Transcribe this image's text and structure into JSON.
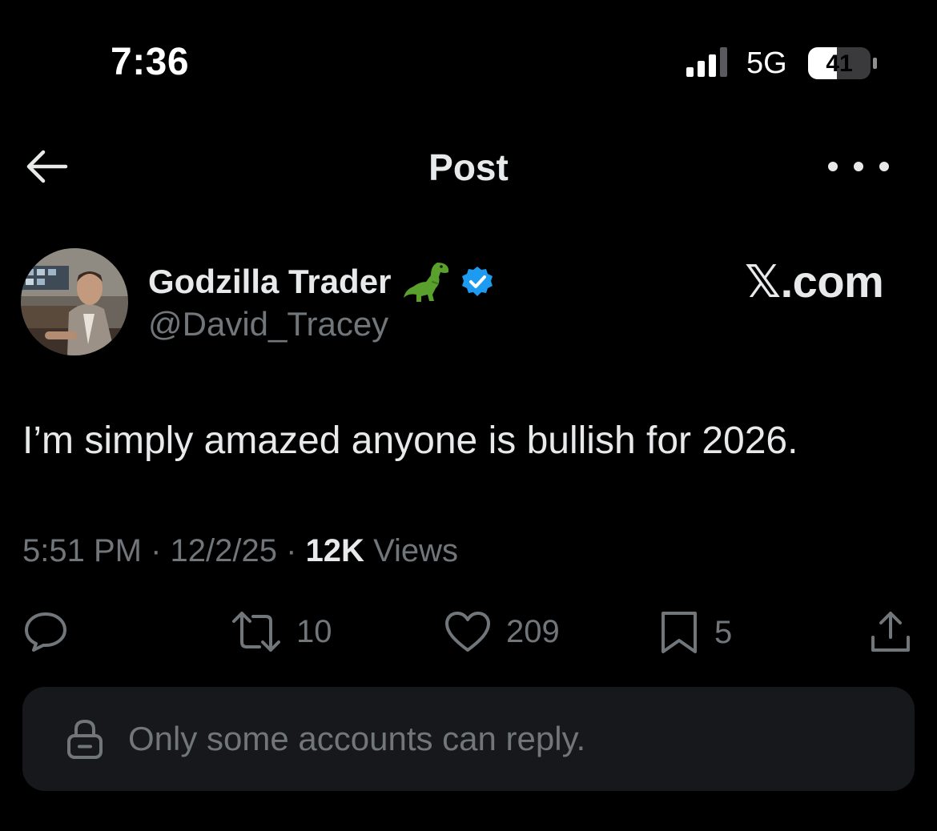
{
  "status_bar": {
    "time": "7:36",
    "network": "5G",
    "battery": "41"
  },
  "header": {
    "title": "Post",
    "back_icon": "arrow-left-icon",
    "more_icon": "ellipsis-icon"
  },
  "author": {
    "display_name": "Godzilla Trader",
    "emoji_icon": "dinosaur-icon",
    "verified_icon": "verified-badge-icon",
    "handle": "@David_Tracey"
  },
  "watermark": "𝕏.com",
  "post": {
    "text": "I’m simply amazed anyone is bullish for 2026."
  },
  "meta": {
    "time": "5:51 PM",
    "date": "12/2/25",
    "views_count": "12K",
    "views_label": "Views"
  },
  "actions": {
    "reply_count": "",
    "retweet_count": "10",
    "like_count": "209",
    "bookmark_count": "5"
  },
  "reply_restriction": {
    "text": "Only some accounts can reply."
  },
  "colors": {
    "background": "#000000",
    "text_primary": "#e7e9ea",
    "text_secondary": "#71767b",
    "verified_blue": "#1d9bf0",
    "reply_box_bg": "#16181c"
  }
}
